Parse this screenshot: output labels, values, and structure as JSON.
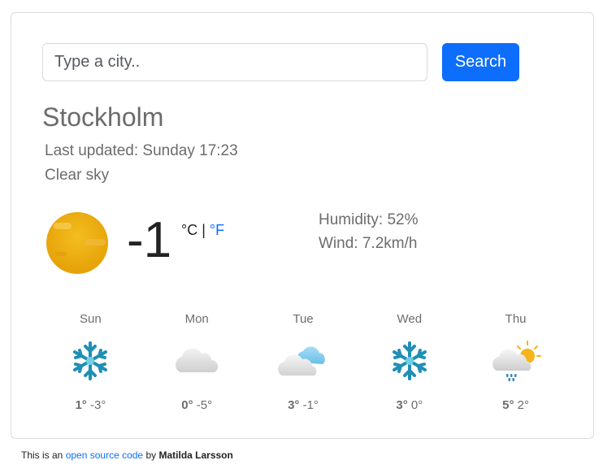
{
  "search": {
    "placeholder": "Type a city..",
    "button_label": "Search"
  },
  "current": {
    "city": "Stockholm",
    "last_updated": "Last updated: Sunday 17:23",
    "description": "Clear sky",
    "icon": "clear-sky-sun-icon",
    "temperature": "-1",
    "unit_c": "°C",
    "unit_separator": " | ",
    "unit_f": "°F",
    "humidity": "Humidity: 52%",
    "wind": "Wind: 7.2km/h"
  },
  "forecast": [
    {
      "day": "Sun",
      "icon": "snow-icon",
      "max": "1°",
      "min": "-3°"
    },
    {
      "day": "Mon",
      "icon": "cloud-icon",
      "max": "0°",
      "min": "-5°"
    },
    {
      "day": "Tue",
      "icon": "cloudy-icon",
      "max": "3°",
      "min": "-1°"
    },
    {
      "day": "Wed",
      "icon": "snow-icon",
      "max": "3°",
      "min": "0°"
    },
    {
      "day": "Thu",
      "icon": "sun-cloud-rain-icon",
      "max": "5°",
      "min": "2°"
    }
  ],
  "footer": {
    "prefix": "This is an",
    "link_text": "open source code",
    "middle": "by",
    "author": "Matilda Larsson"
  },
  "colors": {
    "accent": "#0d6efd",
    "sun": "#f7b500"
  }
}
